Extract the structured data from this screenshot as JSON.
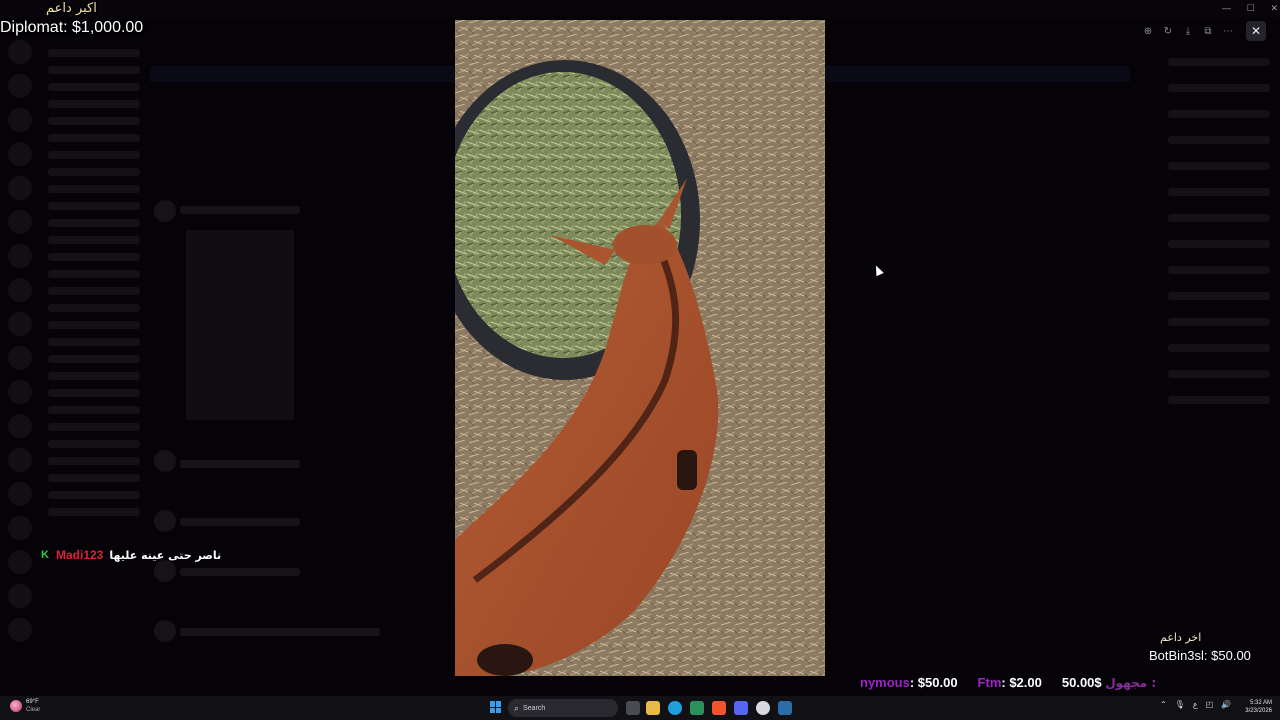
{
  "overlay": {
    "top_left_name": "اكبر داعم",
    "top_left_donation": "Diplomat: $1,000.00",
    "bottom_right_name": "اخر داعم",
    "bottom_right_donation": "BotBin3sl: $50.00"
  },
  "chat": {
    "badge": "K",
    "username": "Madi123",
    "message": "ناصر حتى عينه عليها"
  },
  "ticker": [
    {
      "name": "nymous",
      "amount": ": $50.00"
    },
    {
      "name": "Ftm",
      "amount": ": $2.00"
    },
    {
      "name": "مجهول :",
      "amount": "50.00$"
    }
  ],
  "viewer": {
    "toolbar_icons": [
      "zoom-in-icon",
      "rotate-icon",
      "download-icon",
      "open-external-icon",
      "more-icon"
    ],
    "toolbar_glyphs": [
      "⊕",
      "↻",
      "⤓",
      "⧉",
      "⋯"
    ],
    "close_glyph": "✕"
  },
  "taskbar": {
    "weather_temp": "69°F",
    "weather_cond": "Clear",
    "search_placeholder": "Search",
    "time": "5:32 AM",
    "date": "3/23/2026"
  },
  "colors": {
    "chat_username": "#e0213a",
    "ticker_name": "#9b25c9",
    "goat": "#a8532f",
    "taskbar": "#111015"
  }
}
